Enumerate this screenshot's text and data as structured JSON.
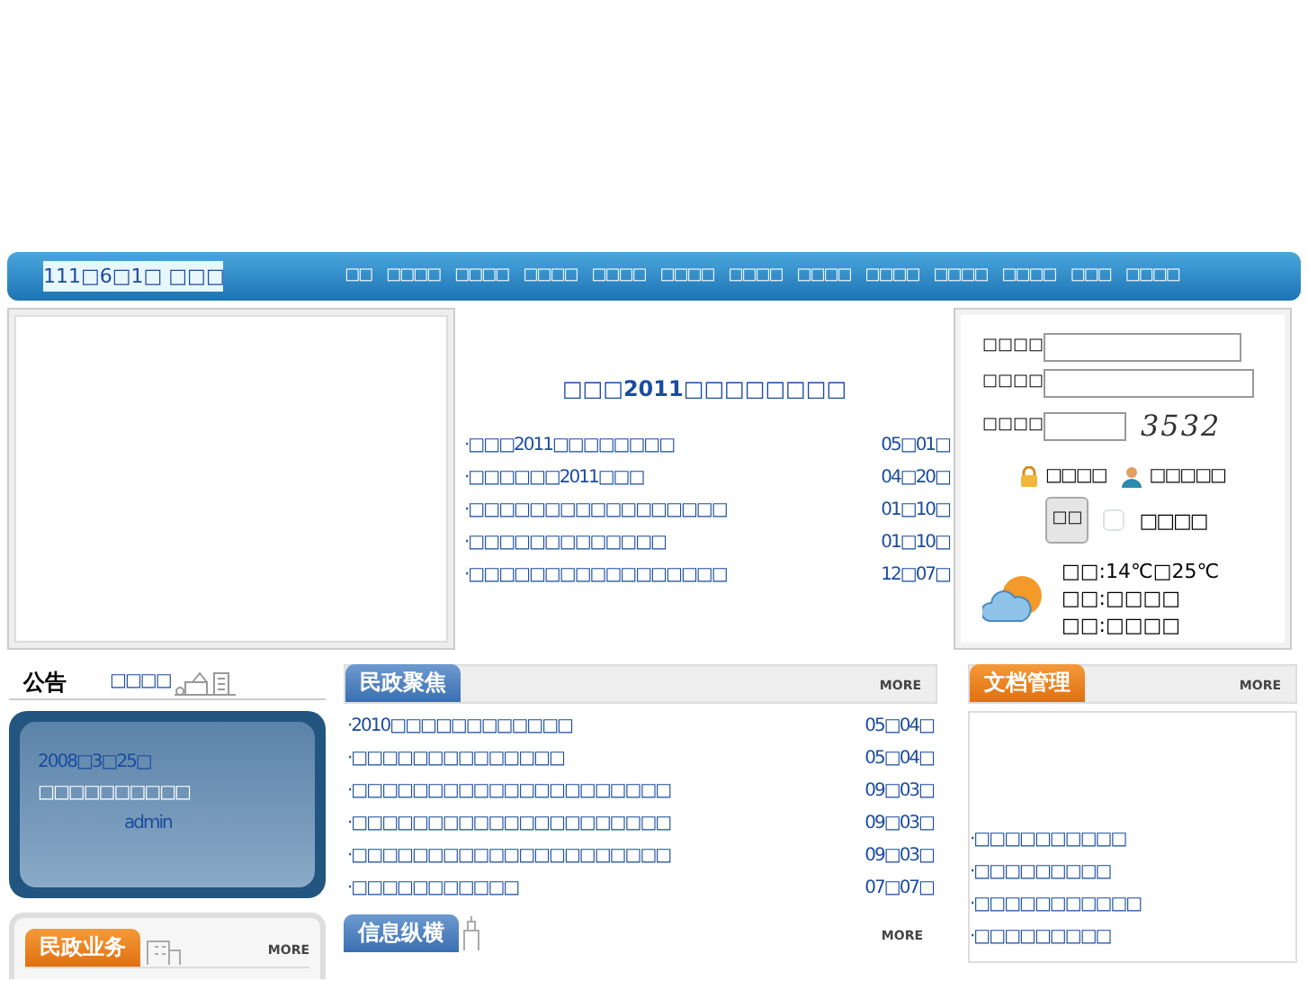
{
  "nav": {
    "date": "111□6□1□ □□□",
    "menu": [
      "□□",
      "□□□□",
      "□□□□",
      "□□□□",
      "□□□□",
      "□□□□",
      "□□□□",
      "□□□□",
      "□□□□",
      "□□□□",
      "□□□□",
      "□□□",
      "□□□□"
    ]
  },
  "headline": {
    "title": "□□□2011□□□□□□□□",
    "items": [
      {
        "title": "·□□□2011□□□□□□□□",
        "date": "05□01□"
      },
      {
        "title": "·□□□□□□2011□□□",
        "date": "04□20□"
      },
      {
        "title": "·□□□□□□□□□□□□□□□□□",
        "date": "01□10□"
      },
      {
        "title": "·□□□□□□□□□□□□□",
        "date": "01□10□"
      },
      {
        "title": "·□□□□□□□□□□□□□□□□□",
        "date": "12□07□"
      }
    ]
  },
  "login": {
    "fields": [
      {
        "label": "□□□□"
      },
      {
        "label": "□□□□"
      },
      {
        "label": "□□□□",
        "captcha": "3532"
      }
    ],
    "links": [
      {
        "kind": "lock",
        "text": "□□□□"
      },
      {
        "kind": "person",
        "text": "□□□□□"
      }
    ],
    "button": "□□",
    "remember": {
      "label": "□□□□",
      "checked": false
    },
    "weather": [
      "□□:14℃□25℃",
      "□□:□□□□",
      "□□:□□□□"
    ]
  },
  "notice": {
    "title": "公告",
    "link": "□□□□",
    "lines": [
      {
        "kind": "date",
        "text": "2008□3□25□"
      },
      {
        "kind": "title",
        "text": "□□□□□□□□□□"
      },
      {
        "kind": "author",
        "text": "admin"
      }
    ]
  },
  "business": {
    "title": "民政业务",
    "more": "MORE"
  },
  "focus": {
    "title": "民政聚焦",
    "more": "MORE",
    "items": [
      {
        "title": "·2010□□□□□□□□□□□□",
        "date": "05□04□"
      },
      {
        "title": "·□□□□□□□□□□□□□□",
        "date": "05□04□"
      },
      {
        "title": "·□□□□□□□□□□□□□□□□□□□□□",
        "date": "09□03□"
      },
      {
        "title": "·□□□□□□□□□□□□□□□□□□□□□",
        "date": "09□03□"
      },
      {
        "title": "·□□□□□□□□□□□□□□□□□□□□□",
        "date": "09□03□"
      },
      {
        "title": "·□□□□□□□□□□□",
        "date": "07□07□"
      }
    ]
  },
  "info": {
    "title": "信息纵横",
    "more": "MORE"
  },
  "docs": {
    "title": "文档管理",
    "more": "MORE",
    "items": [
      "·□□□□□□□□□□",
      "·□□□□□□□□□",
      "·□□□□□□□□□□□",
      "·□□□□□□□□□"
    ]
  }
}
